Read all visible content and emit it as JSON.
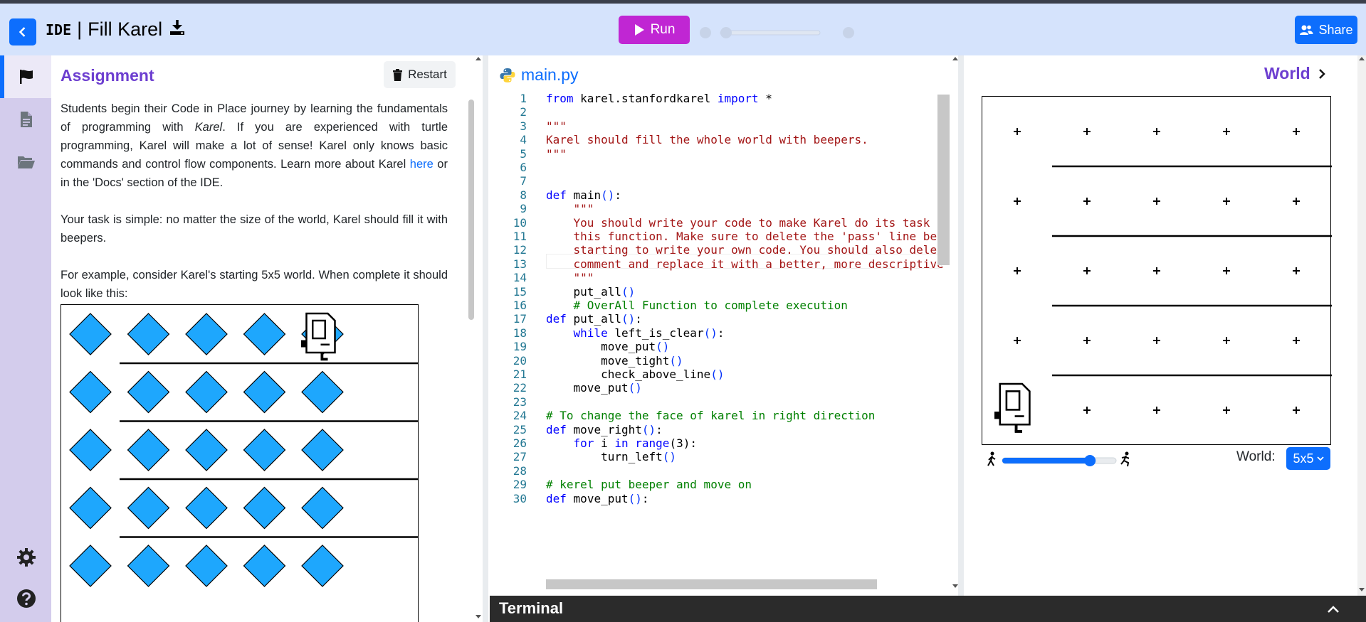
{
  "header": {
    "ide_label": "IDE",
    "separator": "|",
    "title": "Fill Karel",
    "run_label": "Run",
    "share_label": "Share"
  },
  "rail": {
    "items": [
      "flag-icon",
      "document-icon",
      "folder-icon"
    ],
    "bottom": [
      "gear-icon",
      "help-icon"
    ]
  },
  "assignment": {
    "title": "Assignment",
    "restart_label": "Restart",
    "para1_a": "Students begin their Code in Place journey by learning the fundamentals of programming with ",
    "para1_karel": "Karel",
    "para1_b": ". If you are experienced with turtle programming, Karel will make a lot of sense! Karel only knows basic commands and control flow components.  Learn more about Karel ",
    "para1_link": "here",
    "para1_c": " or in the 'Docs' section of the IDE.",
    "para2": "Your task is simple: no matter the size of the world, Karel should fill it with beepers.",
    "para3": "For example, consider Karel's starting 5x5 world. When complete it should look like this:"
  },
  "editor": {
    "filename": "main.py",
    "lines": [
      "from karel.stanfordkarel import *",
      "",
      "\"\"\"",
      "Karel should fill the whole world with beepers.",
      "\"\"\"",
      "",
      "",
      "def main():",
      "    \"\"\"",
      "    You should write your code to make Karel do its task in",
      "    this function. Make sure to delete the 'pass' line befo",
      "    starting to write your own code. You should also delete",
      "    comment and replace it with a better, more descriptive",
      "    \"\"\"",
      "    put_all()",
      "    # OverAll Function to complete execution",
      "def put_all():",
      "    while left_is_clear():",
      "        move_put()",
      "        move_tight()",
      "        check_above_line()",
      "    move_put()",
      "",
      "# To change the face of karel in right direction",
      "def move_right():",
      "    for i in range(3):",
      "        turn_left()",
      "",
      "# kerel put beeper and move on",
      "def move_put():"
    ]
  },
  "world": {
    "title": "World",
    "world_label": "World:",
    "world_size": "5x5",
    "speed": 0.77
  },
  "terminal": {
    "label": "Terminal"
  },
  "colors": {
    "accent_blue": "#0d6efd",
    "run_magenta": "#c026d3",
    "title_purple": "#6d3fd0",
    "beeper_blue": "#1ea7fd"
  }
}
